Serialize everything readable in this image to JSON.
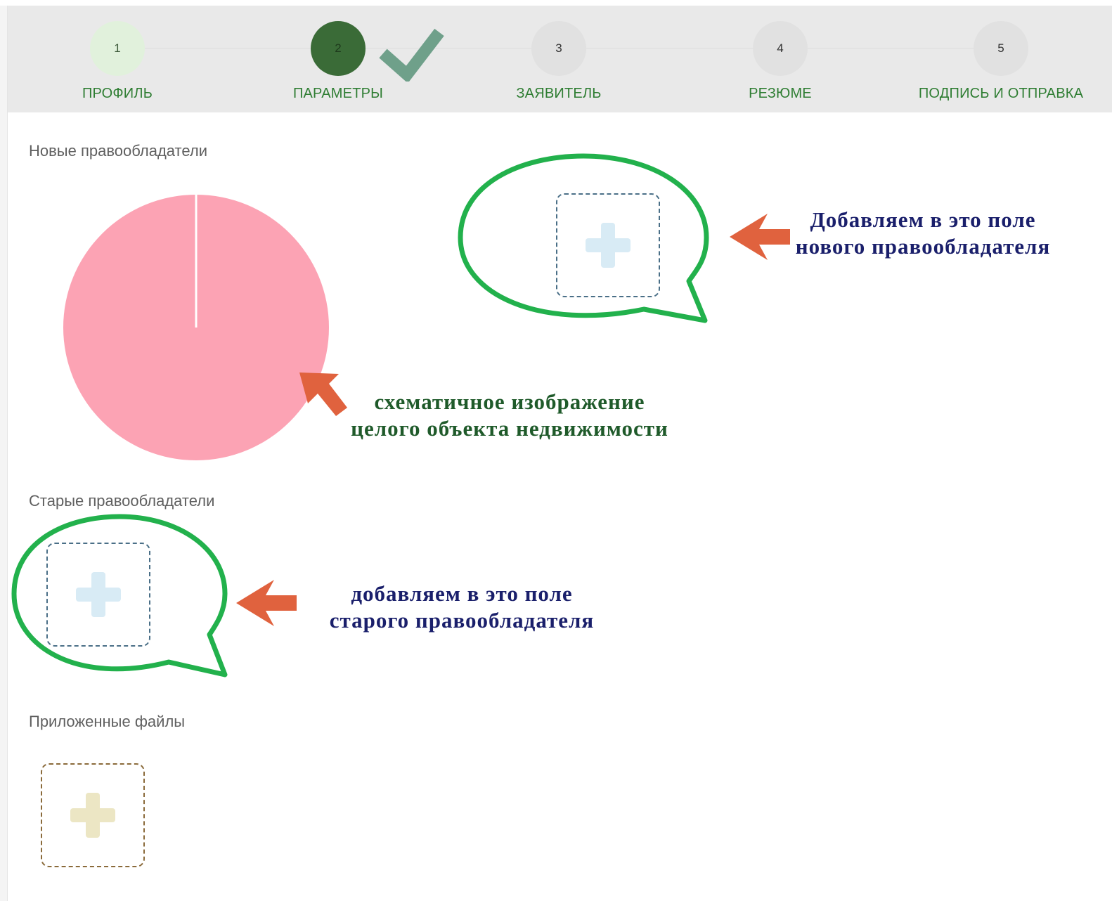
{
  "stepper": {
    "steps": [
      {
        "number": "1",
        "label": "ПРОФИЛЬ",
        "state": "done"
      },
      {
        "number": "2",
        "label": "ПАРАМЕТРЫ",
        "state": "active"
      },
      {
        "number": "3",
        "label": "ЗАЯВИТЕЛЬ",
        "state": "pending"
      },
      {
        "number": "4",
        "label": "РЕЗЮМЕ",
        "state": "pending"
      },
      {
        "number": "5",
        "label": "ПОДПИСЬ И ОТПРАВКА",
        "state": "pending"
      }
    ]
  },
  "sections": {
    "new_holders": {
      "title": "Новые правообладатели"
    },
    "old_holders": {
      "title": "Старые правообладатели"
    },
    "files": {
      "title": "Приложенные файлы"
    }
  },
  "annotations": {
    "new_holder_note": [
      "Добавляем в это поле",
      "нового правообладателя"
    ],
    "pie_note": [
      "схематичное изображение",
      "целого объекта недвижимости"
    ],
    "old_holder_note": [
      "добавляем в это поле",
      "старого правообладателя"
    ]
  },
  "icons": {
    "add": "plus-icon",
    "check": "checkmark-icon",
    "arrow": "arrow-icon"
  },
  "colors": {
    "accent_green": "#2e7d32",
    "active_step": "#3a6b37",
    "done_step": "#e1f1dc",
    "pie_fill": "#fca3b4",
    "callout_green": "#22b14c",
    "arrow_orange": "#e0623e",
    "annotation_navy": "#1a1f6b",
    "annotation_green": "#1f5a2a"
  }
}
